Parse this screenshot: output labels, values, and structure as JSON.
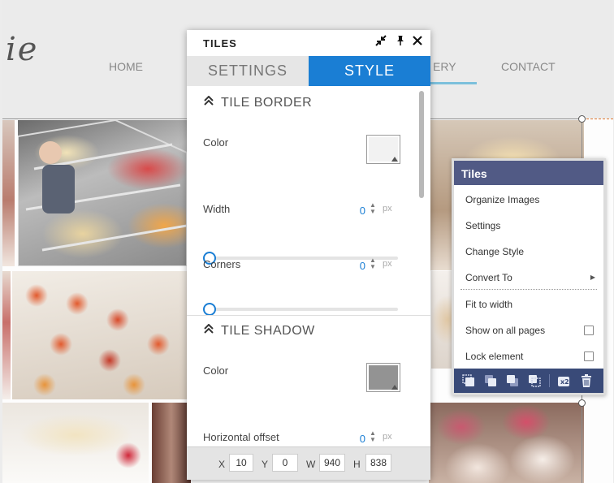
{
  "site": {
    "logo_fragment": "ie",
    "nav": [
      {
        "label": "HOME"
      },
      {
        "label": "ERY"
      },
      {
        "label": "CONTACT"
      }
    ]
  },
  "panel": {
    "title": "TILES",
    "icons": [
      "collapse-icon",
      "pin-icon",
      "close-icon"
    ],
    "tabs": [
      {
        "label": "SETTINGS",
        "active": false
      },
      {
        "label": "STYLE",
        "active": true
      }
    ],
    "tile_border": {
      "title": "TILE BORDER",
      "color_label": "Color",
      "color_value": "#f2f2f2",
      "width_label": "Width",
      "width_value": "0",
      "width_unit": "px",
      "width_level": 0,
      "corners_label": "Corners",
      "corners_value": "0",
      "corners_unit": "px",
      "corners_level": 0
    },
    "tile_shadow": {
      "title": "TILE SHADOW",
      "color_label": "Color",
      "color_value": "#939393",
      "h_offset_label": "Horizontal offset",
      "h_offset_value": "0",
      "h_offset_unit": "px"
    },
    "footer": {
      "x_label": "X",
      "x_value": "10",
      "y_label": "Y",
      "y_value": "0",
      "w_label": "W",
      "w_value": "940",
      "h_label": "H",
      "h_value": "838"
    }
  },
  "context_menu": {
    "title": "Tiles",
    "items": [
      {
        "label": "Organize Images"
      },
      {
        "label": "Settings"
      },
      {
        "label": "Change Style"
      },
      {
        "label": "Convert To",
        "has_submenu": true
      },
      {
        "label": "Fit to width"
      },
      {
        "label": "Show on all pages",
        "checked": false
      },
      {
        "label": "Lock element",
        "checked": false
      }
    ],
    "toolbar_icons": [
      "bring-to-front-icon",
      "bring-forward-icon",
      "send-backward-icon",
      "send-to-back-icon",
      "duplicate-icon",
      "trash-icon"
    ]
  },
  "colors": {
    "accent": "#1a7ed4",
    "menu_header": "#515a85",
    "menu_footer": "#394a78"
  }
}
